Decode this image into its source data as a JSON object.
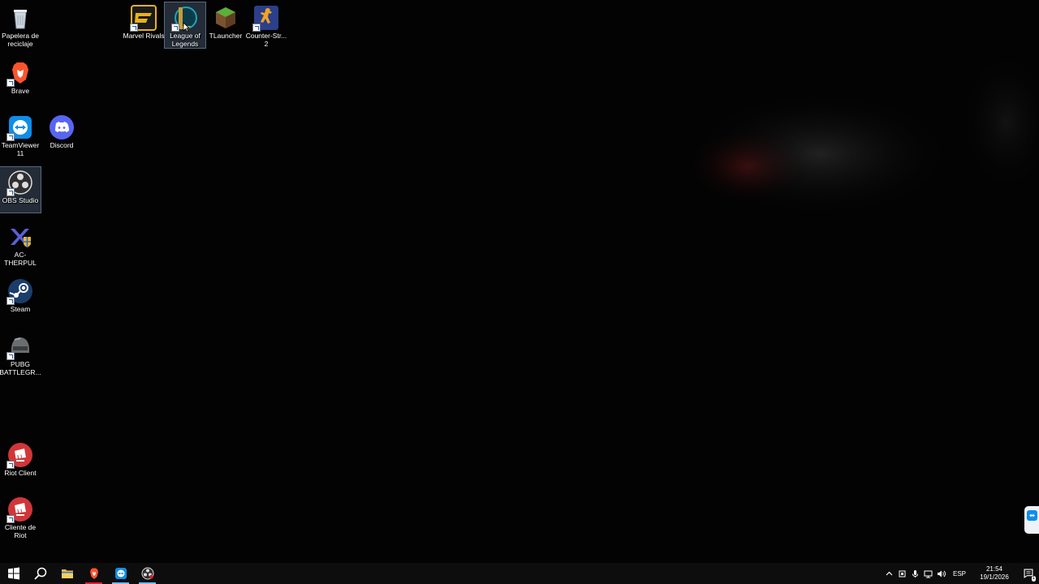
{
  "desktop": {
    "icons": [
      {
        "label": "Papelera de reciclaje",
        "icon": "recycle-bin-icon"
      },
      {
        "label": "Brave",
        "icon": "brave-icon"
      },
      {
        "label": "TeamViewer 11",
        "icon": "teamviewer-icon"
      },
      {
        "label": "Discord",
        "icon": "discord-icon"
      },
      {
        "label": "OBS Studio",
        "icon": "obs-icon"
      },
      {
        "label": "AC-THERPUL",
        "icon": "ac-therpul-icon"
      },
      {
        "label": "Steam",
        "icon": "steam-icon"
      },
      {
        "label": "PUBG BATTLEGR...",
        "icon": "pubg-icon"
      },
      {
        "label": "Riot Client",
        "icon": "riot-client-icon"
      },
      {
        "label": "Cliente de Riot",
        "icon": "riot-client-icon"
      },
      {
        "label": "Marvel Rivals",
        "icon": "marvel-rivals-icon"
      },
      {
        "label": "League of Legends",
        "icon": "league-of-legends-icon"
      },
      {
        "label": "TLauncher",
        "icon": "tlauncher-icon"
      },
      {
        "label": "Counter-Str... 2",
        "icon": "counter-strike-icon"
      }
    ],
    "selected": [
      "OBS Studio",
      "League of Legends"
    ]
  },
  "taskbar": {
    "buttons": [
      {
        "icon": "windows-start-icon"
      },
      {
        "icon": "search-icon"
      },
      {
        "icon": "file-explorer-icon"
      },
      {
        "icon": "brave-icon",
        "running": true
      },
      {
        "icon": "teamviewer-icon",
        "running": true
      },
      {
        "icon": "obs-icon",
        "running": true
      }
    ],
    "tray": {
      "language": "ESP",
      "time": "21:54",
      "date": "19/1/2026",
      "notification_count": "1"
    }
  },
  "colors": {
    "taskbar": "#0d0d0e",
    "desktop": "#030303",
    "accent": "#76b9ed"
  }
}
